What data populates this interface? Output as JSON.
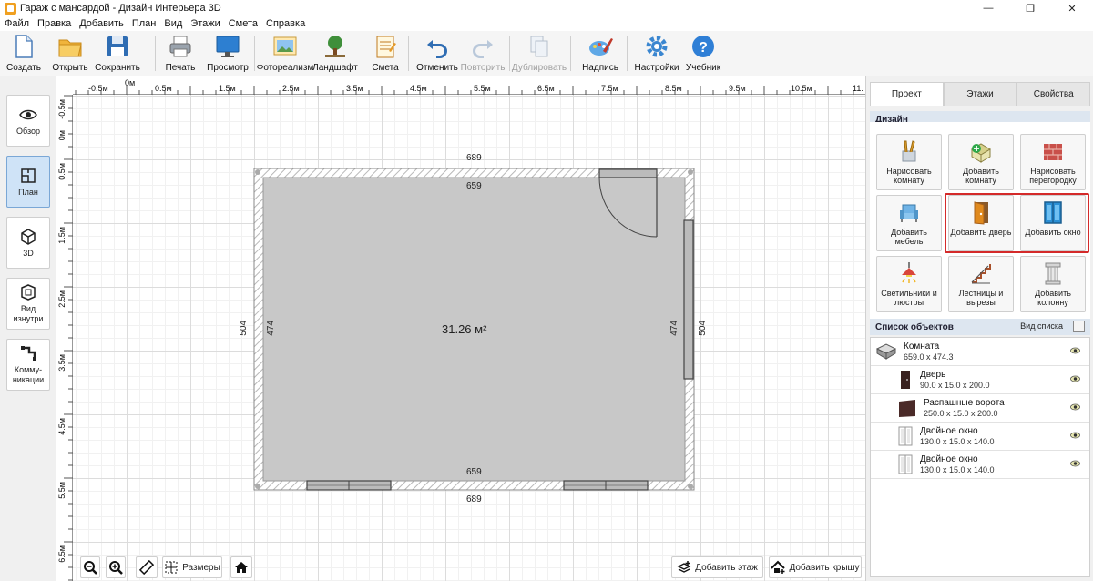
{
  "window": {
    "title": "Гараж с мансардой - Дизайн Интерьера 3D",
    "minimize": "—",
    "maximize": "❐",
    "close": "✕"
  },
  "menu": [
    "Файл",
    "Правка",
    "Добавить",
    "План",
    "Вид",
    "Этажи",
    "Смета",
    "Справка"
  ],
  "toolbar": [
    {
      "id": "create",
      "label": "Создать",
      "icon": "new-file-icon"
    },
    {
      "id": "open",
      "label": "Открыть",
      "icon": "folder-icon"
    },
    {
      "id": "save",
      "label": "Сохранить",
      "icon": "floppy-disk-icon"
    },
    {
      "id": "print",
      "label": "Печать",
      "icon": "printer-icon"
    },
    {
      "id": "preview",
      "label": "Просмотр",
      "icon": "monitor-icon"
    },
    {
      "id": "photorealism",
      "label": "Фотореализм",
      "icon": "picture-icon"
    },
    {
      "id": "landscape",
      "label": "Ландшафт",
      "icon": "tree-icon"
    },
    {
      "id": "estimate",
      "label": "Смета",
      "icon": "notepad-icon"
    },
    {
      "id": "undo",
      "label": "Отменить",
      "icon": "undo-icon"
    },
    {
      "id": "redo",
      "label": "Повторить",
      "icon": "redo-icon",
      "disabled": true
    },
    {
      "id": "duplicate",
      "label": "Дублировать",
      "icon": "duplicate-icon",
      "disabled": true
    },
    {
      "id": "label",
      "label": "Надпись",
      "icon": "palette-brush-icon"
    },
    {
      "id": "settings",
      "label": "Настройки",
      "icon": "gear-icon"
    },
    {
      "id": "tutorial",
      "label": "Учебник",
      "icon": "help-icon"
    }
  ],
  "leftnav": [
    {
      "label": "Обзор",
      "icon": "eye-icon"
    },
    {
      "label": "План",
      "icon": "plan-icon",
      "active": true
    },
    {
      "label": "3D",
      "icon": "cube-icon"
    },
    {
      "label": "Вид изнутри",
      "icon": "inside-view-icon"
    },
    {
      "label": "Комму-никации",
      "icon": "pipes-icon"
    }
  ],
  "ruler": {
    "top": [
      "-0.5м",
      "0м",
      "0.5м",
      "1.5м",
      "2.5м",
      "3.5м",
      "4.5м",
      "5.5м",
      "6.5м",
      "7.5м",
      "8.5м",
      "9.5м",
      "10.5м",
      "11."
    ],
    "left": [
      "-0.5м",
      "0м",
      "0.5м",
      "1.5м",
      "2.5м",
      "3.5м",
      "4.5м",
      "5.5м",
      "6.5м"
    ]
  },
  "plan": {
    "outer_top": "689",
    "inner_top": "659",
    "inner_bottom": "659",
    "outer_bottom": "689",
    "outer_left": "504",
    "inner_left": "474",
    "inner_right": "474",
    "outer_right": "504",
    "area": "31.26 м²",
    "colors": {
      "floor": "#c8c8c8",
      "wall": "#ffffff",
      "hatch": "#b8b8b8",
      "opening": "#aaaaaa"
    }
  },
  "bottom_tools": {
    "zoom_out": "zoom-out-icon",
    "zoom_in": "zoom-in-icon",
    "ruler": "ruler-icon",
    "dimensions": "Размеры",
    "home": "home-icon",
    "add_floor": "Добавить этаж",
    "add_roof": "Добавить крышу"
  },
  "panel": {
    "tabs": [
      "Проект",
      "Этажи",
      "Свойства"
    ],
    "design_title": "Дизайн",
    "design_buttons": [
      {
        "label": "Нарисовать комнату",
        "icon": "brushes-icon"
      },
      {
        "label": "Добавить комнату",
        "icon": "add-room-icon"
      },
      {
        "label": "Нарисовать перегородку",
        "icon": "brick-wall-icon"
      },
      {
        "label": "Добавить мебель",
        "icon": "armchair-icon"
      },
      {
        "label": "Добавить дверь",
        "icon": "door-icon"
      },
      {
        "label": "Добавить окно",
        "icon": "window-icon"
      },
      {
        "label": "Светильники и люстры",
        "icon": "lamp-icon"
      },
      {
        "label": "Лестницы и вырезы",
        "icon": "stairs-icon"
      },
      {
        "label": "Добавить колонну",
        "icon": "column-icon"
      }
    ],
    "objects_title": "Список объектов",
    "view_list": "Вид списка",
    "objects": [
      {
        "name": "Комната",
        "size": "659.0 x 474.3",
        "icon": "room-icon"
      },
      {
        "name": "Дверь",
        "size": "90.0 x 15.0 x 200.0",
        "icon": "door-icon"
      },
      {
        "name": "Распашные ворота",
        "size": "250.0 x 15.0 x 200.0",
        "icon": "gate-icon"
      },
      {
        "name": "Двойное окно",
        "size": "130.0 x 15.0 x 140.0",
        "icon": "double-window-icon"
      },
      {
        "name": "Двойное окно",
        "size": "130.0 x 15.0 x 140.0",
        "icon": "double-window-icon"
      }
    ]
  }
}
